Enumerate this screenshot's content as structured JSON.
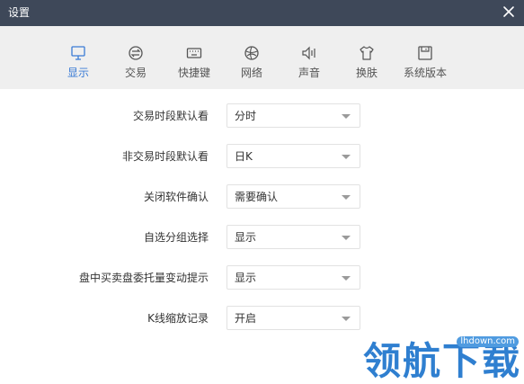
{
  "window": {
    "title": "设置"
  },
  "tabs": [
    {
      "label": "显示",
      "icon": "monitor-icon"
    },
    {
      "label": "交易",
      "icon": "trade-icon"
    },
    {
      "label": "快捷键",
      "icon": "keyboard-icon"
    },
    {
      "label": "网络",
      "icon": "network-icon"
    },
    {
      "label": "声音",
      "icon": "speaker-icon"
    },
    {
      "label": "换肤",
      "icon": "shirt-icon"
    },
    {
      "label": "系统版本",
      "icon": "save-icon"
    }
  ],
  "active_tab": "显示",
  "settings": [
    {
      "label": "交易时段默认看",
      "value": "分时"
    },
    {
      "label": "非交易时段默认看",
      "value": "日K"
    },
    {
      "label": "关闭软件确认",
      "value": "需要确认"
    },
    {
      "label": "自选分组选择",
      "value": "显示"
    },
    {
      "label": "盘中买卖盘委托量变动提示",
      "value": "显示"
    },
    {
      "label": "K线缩放记录",
      "value": "开启"
    }
  ],
  "watermark": {
    "site": "lhdown.com",
    "text": "领航下载"
  },
  "colors": {
    "titlebar": "#3e4859",
    "tabbar": "#efefef",
    "accent": "#3a7bd5",
    "watermark": "#2f7fd0"
  }
}
